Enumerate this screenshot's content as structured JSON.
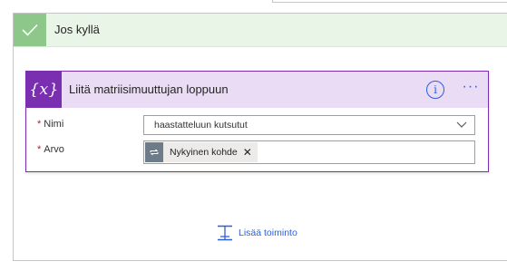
{
  "condition": {
    "title": "Jos kyllä",
    "check_icon": "checkmark-icon",
    "color": "#8dc88a"
  },
  "action_card": {
    "title": "Liitä matriisimuuttujan loppuun",
    "icon_text": "{x}",
    "icon": "variable-icon",
    "accent_color": "#7a2fb1",
    "info_icon": "info-icon",
    "more_icon": "more-ellipsis-icon",
    "more_label": "···",
    "fields": {
      "name": {
        "label": "Nimi",
        "required_mark": "*",
        "value": "haastatteluun kutsutut"
      },
      "value": {
        "label": "Arvo",
        "required_mark": "*",
        "token_label": "Nykyinen kohde",
        "token_icon": "loop-icon",
        "token_close": "✕"
      }
    }
  },
  "add_action": {
    "label": "Lisää toiminto",
    "icon": "add-action-icon",
    "color": "#2b5fd9"
  }
}
